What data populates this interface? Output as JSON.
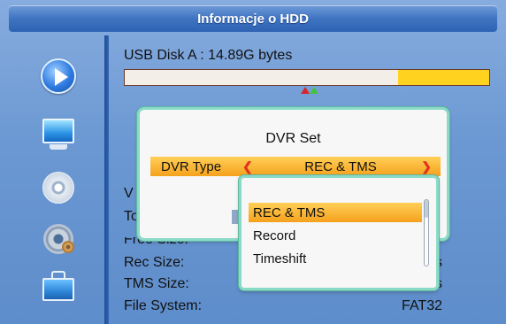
{
  "window": {
    "title": "Informacje o HDD"
  },
  "disk": {
    "label": "USB Disk A : 14.89G bytes",
    "used_fraction": 0.75
  },
  "info": {
    "rows": [
      {
        "label": "V",
        "value": ""
      },
      {
        "label": "To",
        "value": ""
      },
      {
        "label": "Free Size:",
        "value": ""
      },
      {
        "label": "Rec Size:",
        "value": "s"
      },
      {
        "label": "TMS Size:",
        "value": "s"
      },
      {
        "label": "File System:",
        "value": "FAT32"
      }
    ]
  },
  "dvr_set": {
    "title": "DVR Set",
    "type_label": "DVR Type",
    "type_value": "REC & TMS"
  },
  "dropdown": {
    "options": [
      "REC & TMS",
      "Record",
      "Timeshift"
    ],
    "selected": "REC & TMS"
  },
  "sidebar": {
    "icons": [
      "play-icon",
      "tv-icon",
      "disc-icon",
      "gear-icon",
      "briefcase-icon"
    ]
  },
  "colors": {
    "accent": "#f5a11c",
    "highlight": "#ffcf57",
    "panel_border": "#8bdac7",
    "bar_free": "#ffd21f"
  }
}
